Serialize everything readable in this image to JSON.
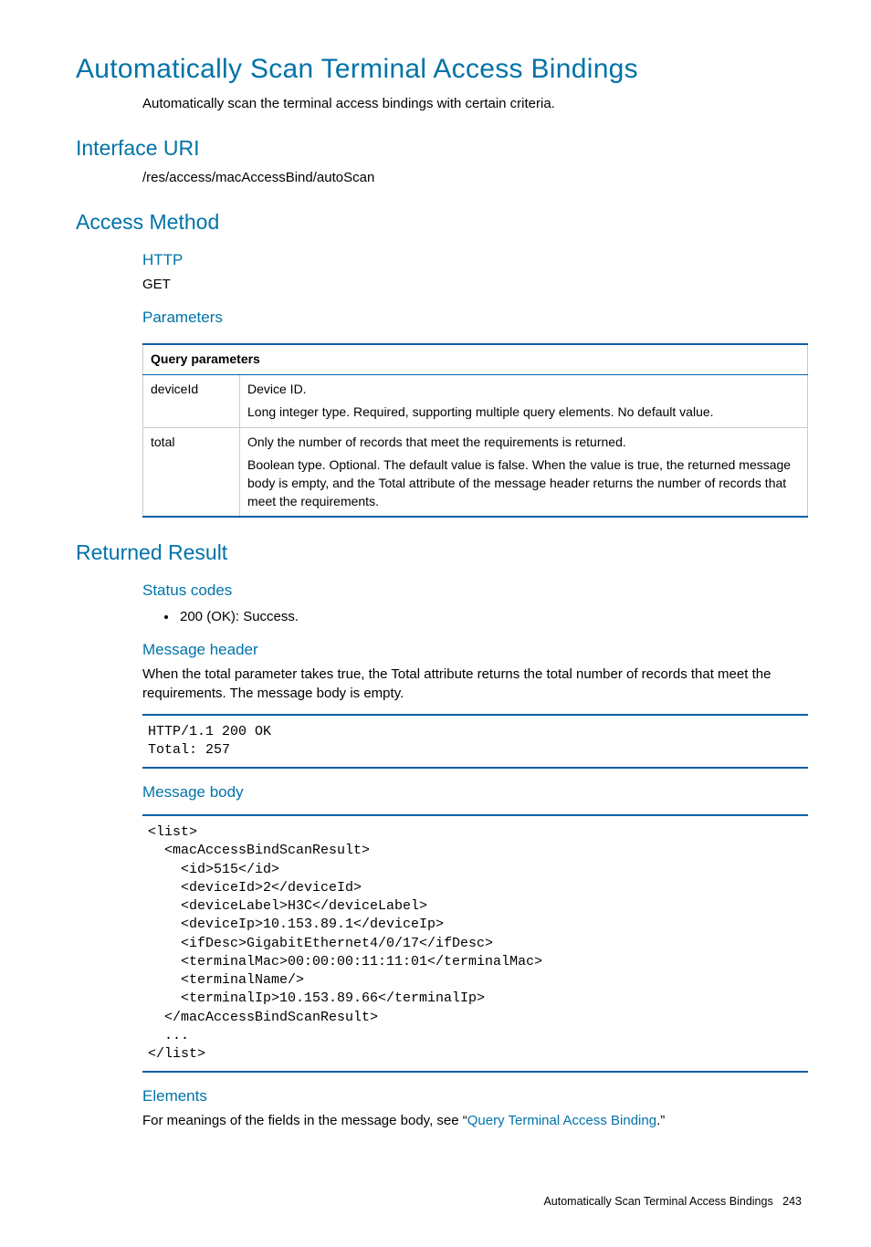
{
  "page": {
    "title": "Automatically Scan Terminal Access Bindings",
    "intro": "Automatically scan the terminal access bindings with certain criteria.",
    "footer_title": "Automatically Scan Terminal Access Bindings",
    "footer_page": "243"
  },
  "interface_uri": {
    "heading": "Interface URI",
    "value": "/res/access/macAccessBind/autoScan"
  },
  "access_method": {
    "heading": "Access Method",
    "http_heading": "HTTP",
    "http_value": "GET",
    "parameters_heading": "Parameters",
    "table_header": "Query parameters",
    "rows": [
      {
        "name": "deviceId",
        "line1": "Device ID.",
        "line2": "Long integer type. Required, supporting multiple query elements. No default value."
      },
      {
        "name": "total",
        "line1": "Only the number of records that meet the requirements is returned.",
        "line2": "Boolean type. Optional. The default value is false. When the value is true, the returned message body is empty, and the Total attribute of the message header returns the number of records that meet the requirements."
      }
    ]
  },
  "returned_result": {
    "heading": "Returned Result",
    "status_codes_heading": "Status codes",
    "status_codes_item": "200 (OK): Success.",
    "message_header_heading": "Message header",
    "message_header_text": "When the total parameter takes true, the Total attribute returns the total number of records that meet the requirements. The message body is empty.",
    "message_header_code": "HTTP/1.1 200 OK\nTotal: 257",
    "message_body_heading": "Message body",
    "message_body_code": "<list>\n  <macAccessBindScanResult>\n    <id>515</id>\n    <deviceId>2</deviceId>\n    <deviceLabel>H3C</deviceLabel>\n    <deviceIp>10.153.89.1</deviceIp>\n    <ifDesc>GigabitEthernet4/0/17</ifDesc>\n    <terminalMac>00:00:00:11:11:01</terminalMac>\n    <terminalName/>\n    <terminalIp>10.153.89.66</terminalIp>\n  </macAccessBindScanResult>\n  ...\n</list>",
    "elements_heading": "Elements",
    "elements_text_before": "For meanings of the fields in the message body, see “",
    "elements_link": "Query Terminal Access Binding",
    "elements_text_after": ".”"
  }
}
